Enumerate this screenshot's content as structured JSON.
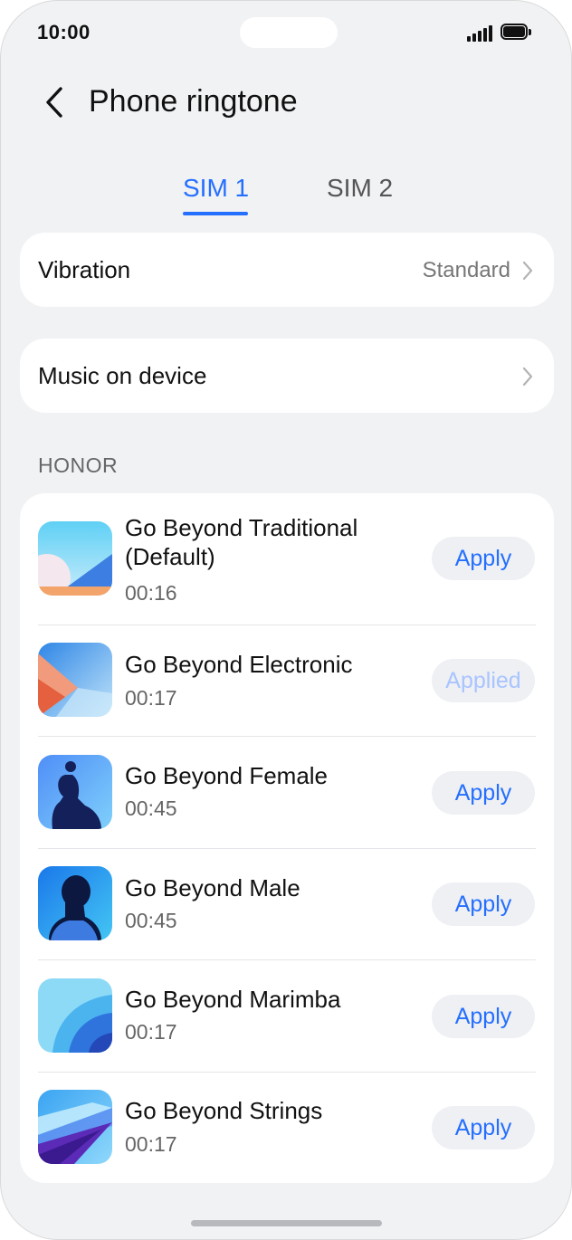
{
  "status_bar": {
    "time": "10:00",
    "signal_icon": "signal-bars-icon",
    "battery_icon": "battery-icon"
  },
  "header": {
    "back_icon": "chevron-left-icon",
    "title": "Phone ringtone"
  },
  "tabs": [
    {
      "label": "SIM 1",
      "selected": true
    },
    {
      "label": "SIM 2",
      "selected": false
    }
  ],
  "vibration": {
    "label": "Vibration",
    "value": "Standard"
  },
  "music_on_device": {
    "label": "Music on device"
  },
  "section": {
    "title": "HONOR"
  },
  "ringtones": [
    {
      "name": "Go Beyond Traditional (Default)",
      "duration": "00:16",
      "action": "Apply",
      "applied": false
    },
    {
      "name": "Go Beyond Electronic",
      "duration": "00:17",
      "action": "Applied",
      "applied": true
    },
    {
      "name": "Go Beyond Female",
      "duration": "00:45",
      "action": "Apply",
      "applied": false
    },
    {
      "name": "Go Beyond Male",
      "duration": "00:45",
      "action": "Apply",
      "applied": false
    },
    {
      "name": "Go Beyond Marimba",
      "duration": "00:17",
      "action": "Apply",
      "applied": false
    },
    {
      "name": "Go Beyond Strings",
      "duration": "00:17",
      "action": "Apply",
      "applied": false
    }
  ],
  "colors": {
    "accent": "#256fff",
    "background": "#f1f2f4",
    "card": "#ffffff",
    "applied_text": "#a9c4ff"
  }
}
